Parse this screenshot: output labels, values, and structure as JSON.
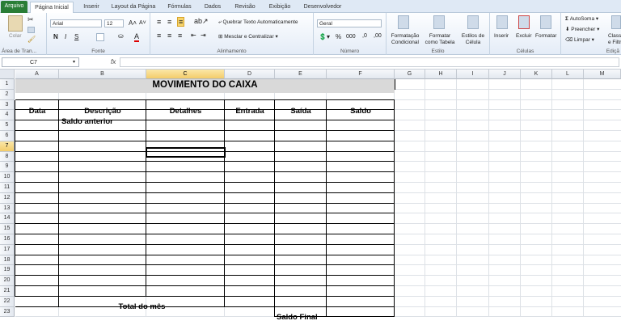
{
  "ribbon_tabs": [
    "Arquivo",
    "Página Inicial",
    "Inserir",
    "Layout da Página",
    "Fórmulas",
    "Dados",
    "Revisão",
    "Exibição",
    "Desenvolvedor"
  ],
  "clipboard": {
    "paste": "Colar",
    "label": "Área de Tran..."
  },
  "font": {
    "name": "Arial",
    "size": "12",
    "label": "Fonte",
    "bold": "N",
    "italic": "I",
    "underline": "S"
  },
  "alignment": {
    "wrap": "Quebrar Texto Automaticamente",
    "merge": "Mesclar e Centralizar",
    "label": "Alinhamento"
  },
  "number": {
    "format": "Geral",
    "label": "Número"
  },
  "styles": {
    "cond": "Formatação Condicional",
    "table": "Formatar como Tabela",
    "cell": "Estilos de Célula",
    "label": "Estilo"
  },
  "cells": {
    "insert": "Inserir",
    "delete": "Excluir",
    "format": "Formatar",
    "label": "Células"
  },
  "editing": {
    "autosum": "AutoSoma",
    "fill": "Preencher",
    "clear": "Limpar",
    "label": "Ediçã",
    "sort": "Classi e Filtr"
  },
  "namebox": "C7",
  "fx": "fx",
  "columns": [
    "A",
    "B",
    "C",
    "D",
    "E",
    "F",
    "G",
    "H",
    "I",
    "J",
    "K",
    "L",
    "M"
  ],
  "rows": [
    "1",
    "2",
    "3",
    "4",
    "5",
    "6",
    "7",
    "8",
    "9",
    "10",
    "11",
    "12",
    "13",
    "14",
    "15",
    "16",
    "17",
    "18",
    "19",
    "20",
    "21",
    "22",
    "23"
  ],
  "sheet": {
    "title": "MOVIMENTO DO CAIXA",
    "headers": [
      "Data",
      "Descrição",
      "Detalhes",
      "Entrada",
      "Saída",
      "Saldo"
    ],
    "saldo_anterior": "Saldo anterior",
    "total_mes": "Total do mês",
    "saldo_final": "Saldo Final"
  }
}
